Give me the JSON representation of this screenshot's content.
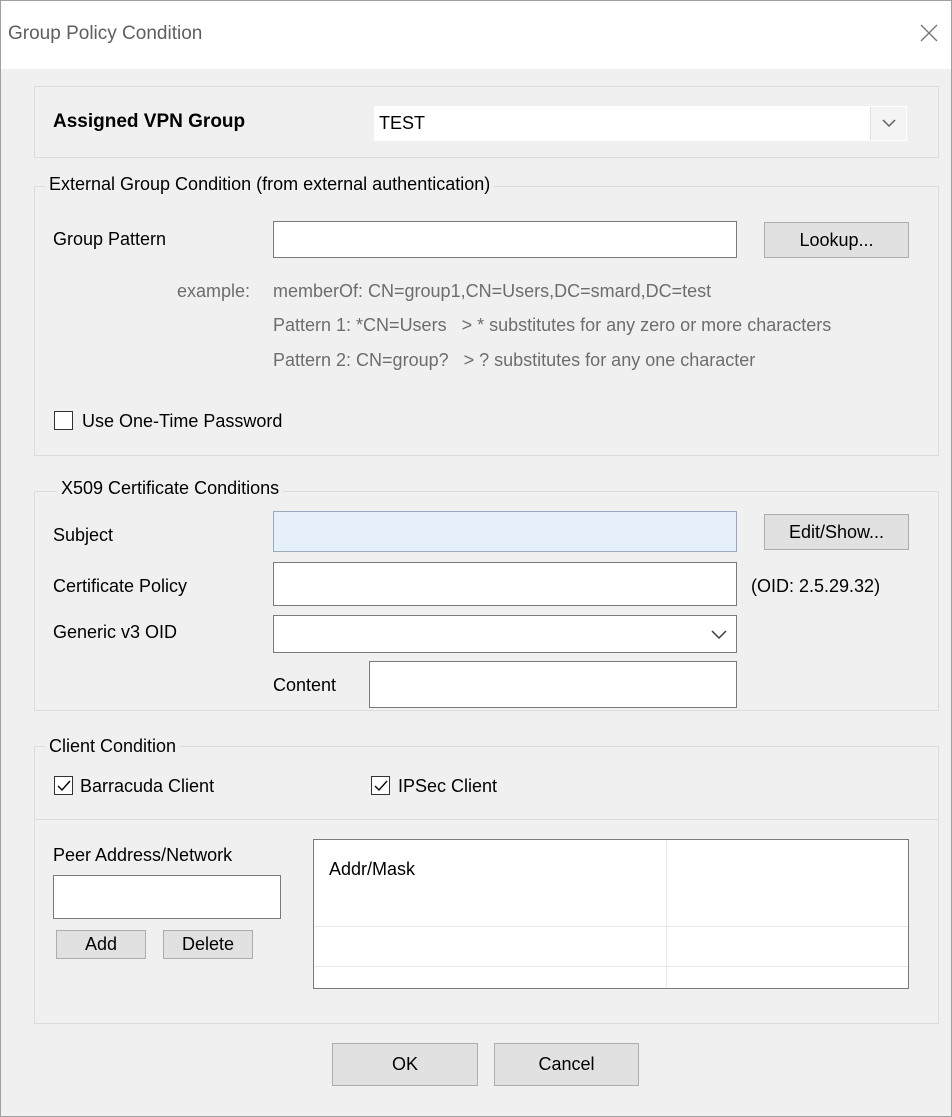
{
  "window": {
    "title": "Group Policy Condition"
  },
  "assigned_vpn_group": {
    "label": "Assigned VPN Group",
    "value": "TEST"
  },
  "external_group": {
    "legend": "External Group Condition (from external authentication)",
    "group_pattern_label": "Group Pattern",
    "group_pattern_value": "",
    "lookup_button": "Lookup...",
    "example_prefix": "example:",
    "example_line": "memberOf: CN=group1,CN=Users,DC=smard,DC=test",
    "pattern1": "Pattern 1: *CN=Users   > * substitutes for any zero or more characters",
    "pattern2": "Pattern 2: CN=group?   > ? substitutes for any one character",
    "otp_label": "Use One-Time Password",
    "otp_checked": false
  },
  "x509": {
    "legend": "X509 Certificate Conditions",
    "subject_label": "Subject",
    "subject_value": "",
    "edit_show_button": "Edit/Show...",
    "cert_policy_label": "Certificate Policy",
    "cert_policy_value": "",
    "oid_note": "(OID: 2.5.29.32)",
    "generic_oid_label": "Generic v3 OID",
    "generic_oid_value": "",
    "content_label": "Content",
    "content_value": ""
  },
  "client": {
    "legend": "Client Condition",
    "barracuda_label": "Barracuda Client",
    "barracuda_checked": true,
    "ipsec_label": "IPSec Client",
    "ipsec_checked": true,
    "peer_label": "Peer Address/Network",
    "peer_value": "",
    "add_button": "Add",
    "delete_button": "Delete",
    "list_column": "Addr/Mask"
  },
  "footer": {
    "ok_button": "OK",
    "cancel_button": "Cancel"
  },
  "colors": {
    "subject_bg": "#e6f0fa",
    "dialog_bg": "#f0f0f0"
  }
}
